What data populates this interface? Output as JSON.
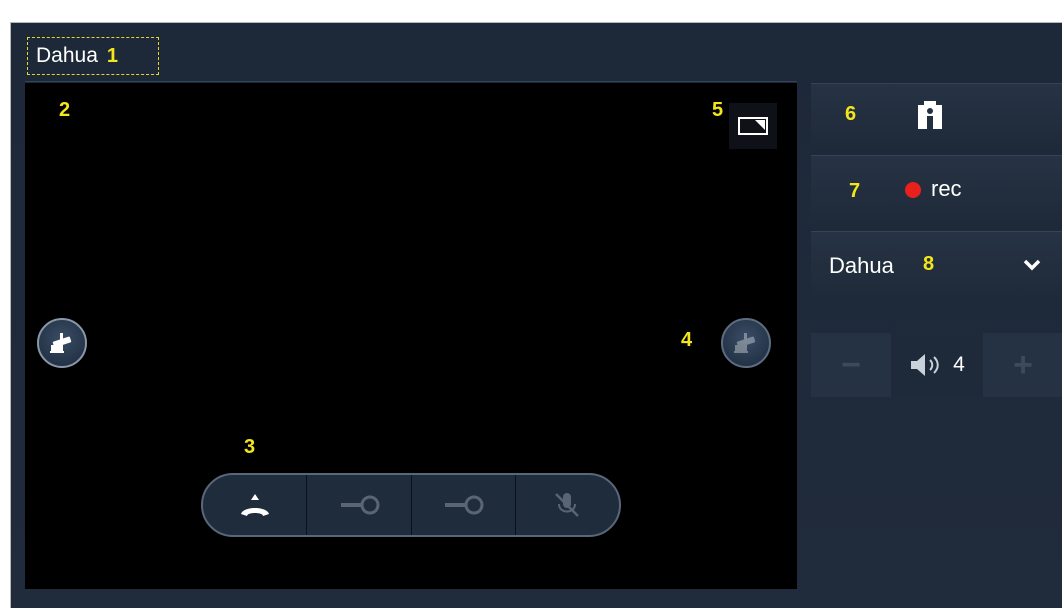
{
  "header": {
    "title": "Dahua",
    "callout": "1"
  },
  "video_view": {
    "callout": "2"
  },
  "call_bar": {
    "callout": "3",
    "buttons": [
      {
        "icon": "hangup-icon",
        "enabled": true
      },
      {
        "icon": "key-icon",
        "enabled": false
      },
      {
        "icon": "key-icon",
        "enabled": false
      },
      {
        "icon": "mute-mic-icon",
        "enabled": false
      }
    ]
  },
  "camera_left": {
    "icon": "camera-icon"
  },
  "camera_right": {
    "callout": "4",
    "icon": "camera-icon"
  },
  "pip": {
    "callout": "5",
    "icon": "picture-in-picture-icon"
  },
  "side": {
    "snapshot": {
      "callout": "6",
      "icon": "snapshot-icon"
    },
    "record": {
      "callout": "7",
      "label": "rec",
      "indicator_color": "#e8211c"
    },
    "device_select": {
      "callout": "8",
      "value": "Dahua"
    },
    "volume": {
      "value": "4",
      "minus": "−",
      "plus": "+"
    }
  }
}
